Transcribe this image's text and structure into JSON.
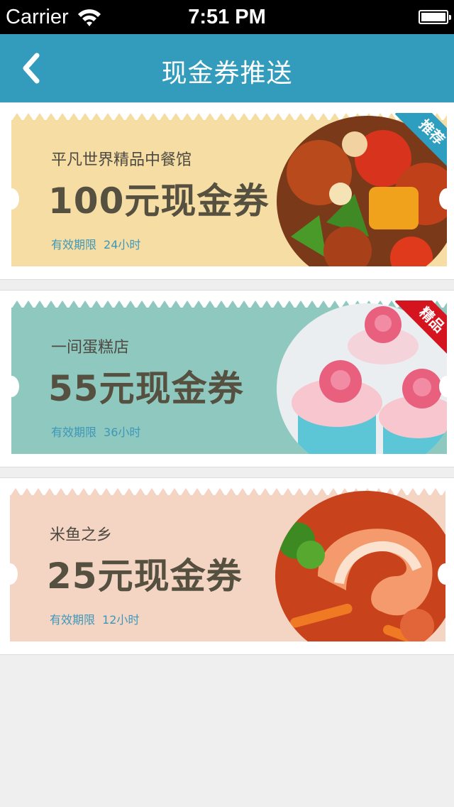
{
  "status_bar": {
    "carrier": "Carrier",
    "time": "7:51 PM"
  },
  "nav": {
    "title": "现金券推送"
  },
  "coupons": [
    {
      "shop": "平凡世界精品中餐馆",
      "amount": "100元现金券",
      "validity_label": "有效期限",
      "validity_value": "24小时",
      "badge": "推荐",
      "badge_color": "#2e9ec0",
      "bg_color": "#f5dda4",
      "photo": "sweet-and-sour-pork-photo"
    },
    {
      "shop": "一间蛋糕店",
      "amount": "55元现金券",
      "validity_label": "有效期限",
      "validity_value": "36小时",
      "badge": "精品",
      "badge_color": "#d4151f",
      "bg_color": "#8ec8bf",
      "photo": "cupcakes-photo"
    },
    {
      "shop": "米鱼之乡",
      "amount": "25元现金券",
      "validity_label": "有效期限",
      "validity_value": "12小时",
      "badge": "",
      "badge_color": "",
      "bg_color": "#f4d5c4",
      "photo": "shrimp-dish-photo"
    }
  ]
}
